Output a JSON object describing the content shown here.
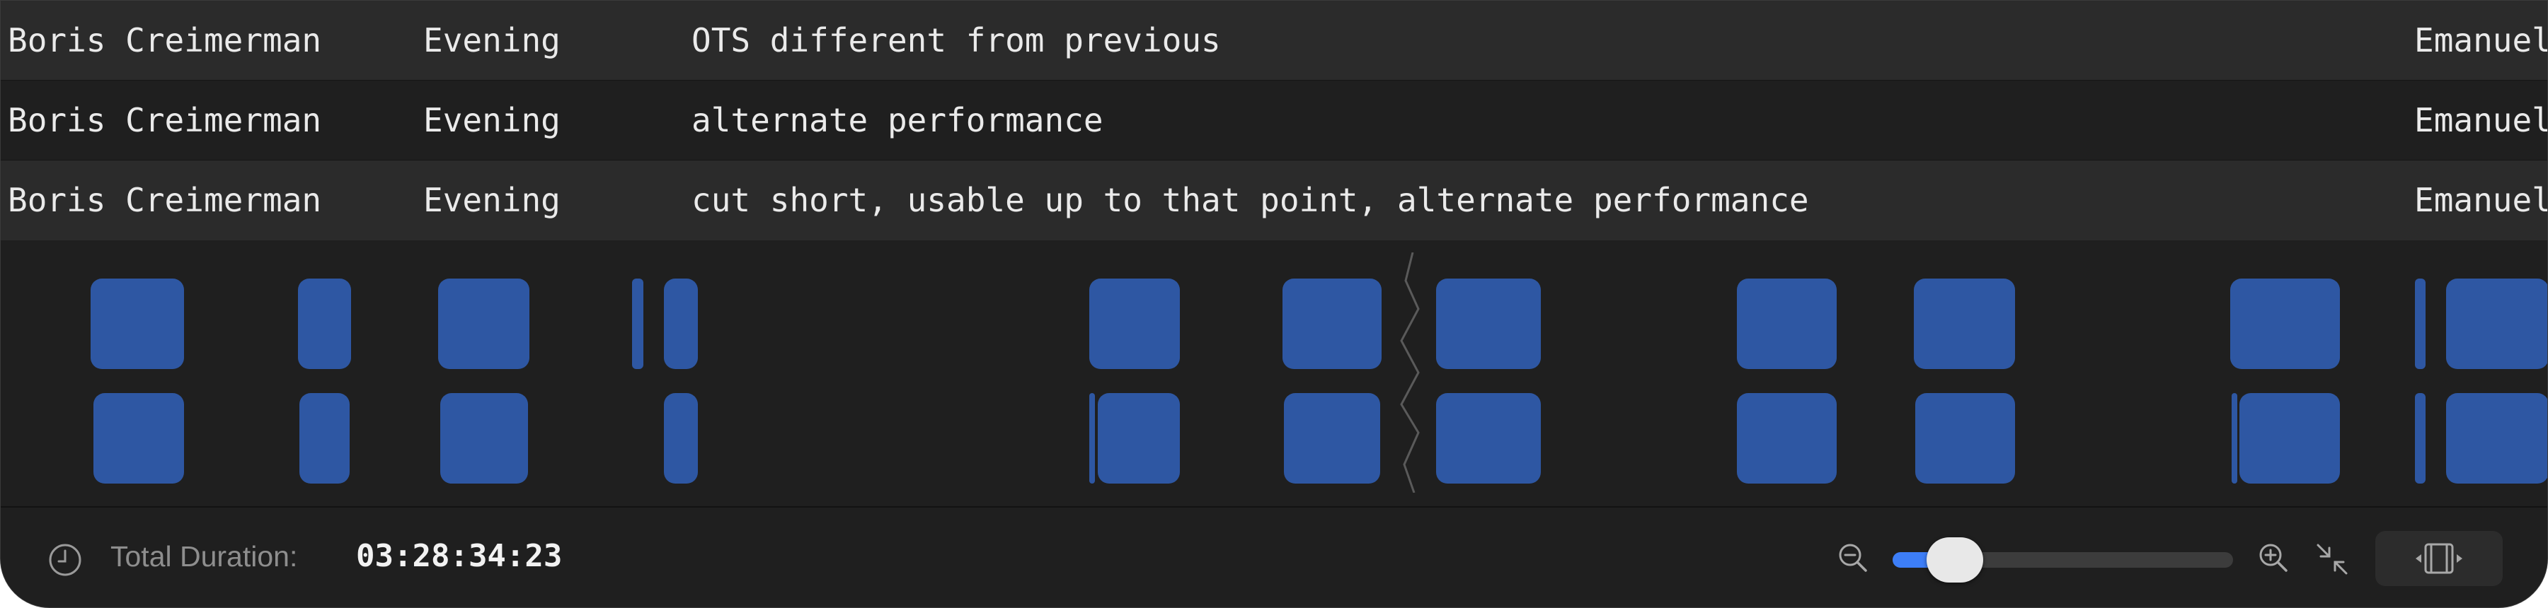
{
  "table": {
    "rows": [
      {
        "name": "Boris Creimerman",
        "time": "Evening",
        "note": "OTS different from previous",
        "person": "Emanuel"
      },
      {
        "name": "Boris Creimerman",
        "time": "Evening",
        "note": "alternate performance",
        "person": "Emanuel"
      },
      {
        "name": "Boris Creimerman",
        "time": "Evening",
        "note": "cut short, usable up to that point, alternate performance",
        "person": "Emanuel"
      }
    ]
  },
  "timeline": {
    "clip_color": "#2e57a3",
    "tracks": 2
  },
  "footer": {
    "duration_label": "Total Duration:",
    "duration_value": "03:28:34:23",
    "zoom_level_percent": 10,
    "icons": [
      "clock-icon",
      "zoom-out-icon",
      "zoom-in-icon",
      "fit-to-window-icon",
      "filmstrip-icon"
    ],
    "accent": "#3d7ef7"
  }
}
